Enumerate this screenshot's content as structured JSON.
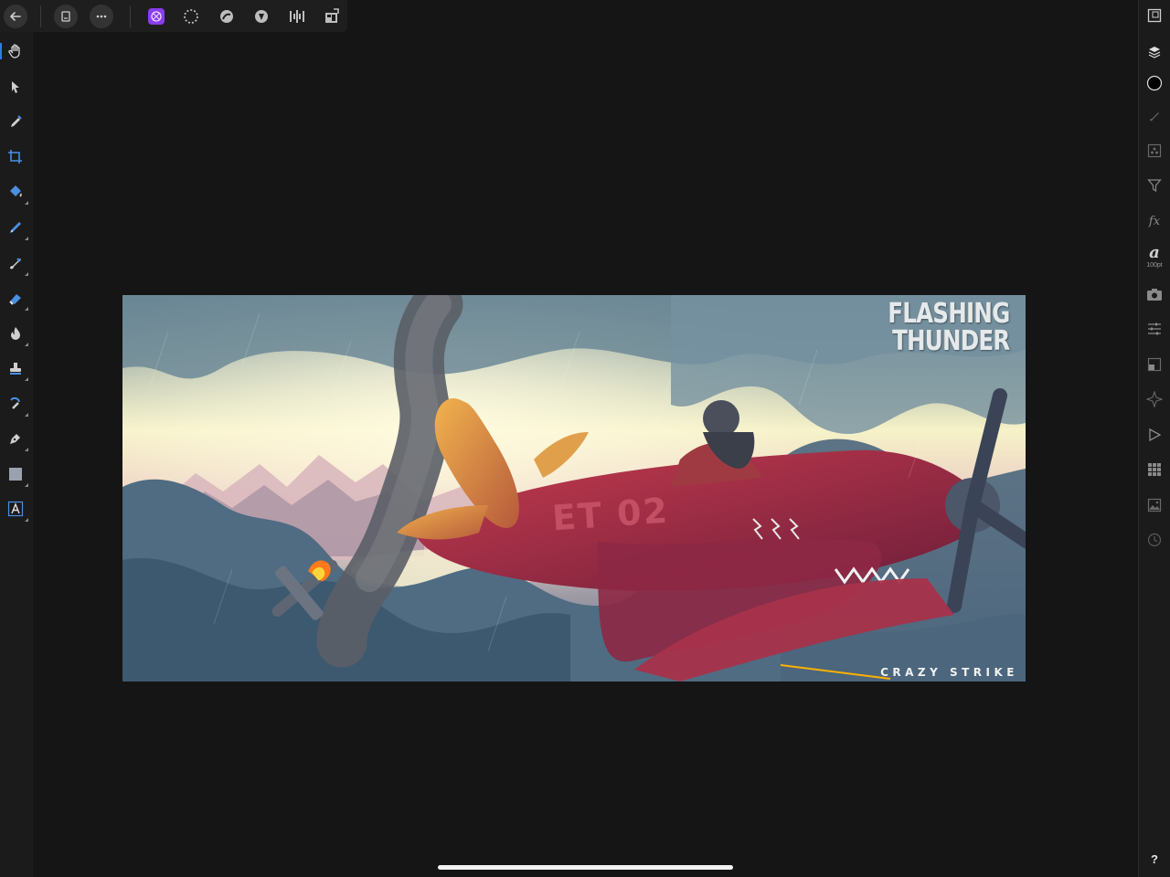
{
  "toolbar": {
    "buttons": [
      {
        "name": "back-button",
        "icon": "arrow-left-icon"
      },
      {
        "name": "document-button",
        "icon": "document-icon"
      },
      {
        "name": "more-button",
        "icon": "ellipsis-icon"
      },
      {
        "name": "photo-persona-button",
        "icon": "photo-persona-icon",
        "active": true
      },
      {
        "name": "selection-persona-button",
        "icon": "selection-persona-icon"
      },
      {
        "name": "liquify-persona-button",
        "icon": "liquify-persona-icon"
      },
      {
        "name": "develop-persona-button",
        "icon": "develop-persona-icon"
      },
      {
        "name": "tone-mapping-persona-button",
        "icon": "tone-mapping-persona-icon"
      },
      {
        "name": "export-persona-button",
        "icon": "export-persona-icon"
      }
    ],
    "accent_color": "#8a3cf0"
  },
  "left_tools": [
    "view-tool-icon",
    "move-tool-icon",
    "color-picker-icon",
    "crop-tool-icon",
    "flood-fill-icon",
    "selection-brush-icon",
    "paint-brush-icon",
    "erase-brush-icon",
    "dodge-brush-icon",
    "clone-brush-icon",
    "healing-brush-icon",
    "pen-tool-icon",
    "rectangle-tool-icon",
    "artistic-text-icon"
  ],
  "right_studio": {
    "items": [
      "navigator-icon",
      "layers-icon",
      "color-icon",
      "brushes-icon",
      "channels-icon",
      "filter-icon",
      "fx-icon",
      "text-style-icon",
      "camera-icon",
      "adjustments-icon",
      "transform-icon",
      "constraints-icon",
      "play-icon",
      "grid-icon",
      "image-icon",
      "history-icon"
    ],
    "fx_label": "fx",
    "text_glyph": "a",
    "text_size": "100pt",
    "help_label": "?",
    "color_swatch": "#000000"
  },
  "artwork": {
    "title_line1": "FLASHING",
    "title_line2": "THUNDER",
    "subtitle": "CRAZY STRIKE",
    "plane_marking": "ET 02"
  }
}
